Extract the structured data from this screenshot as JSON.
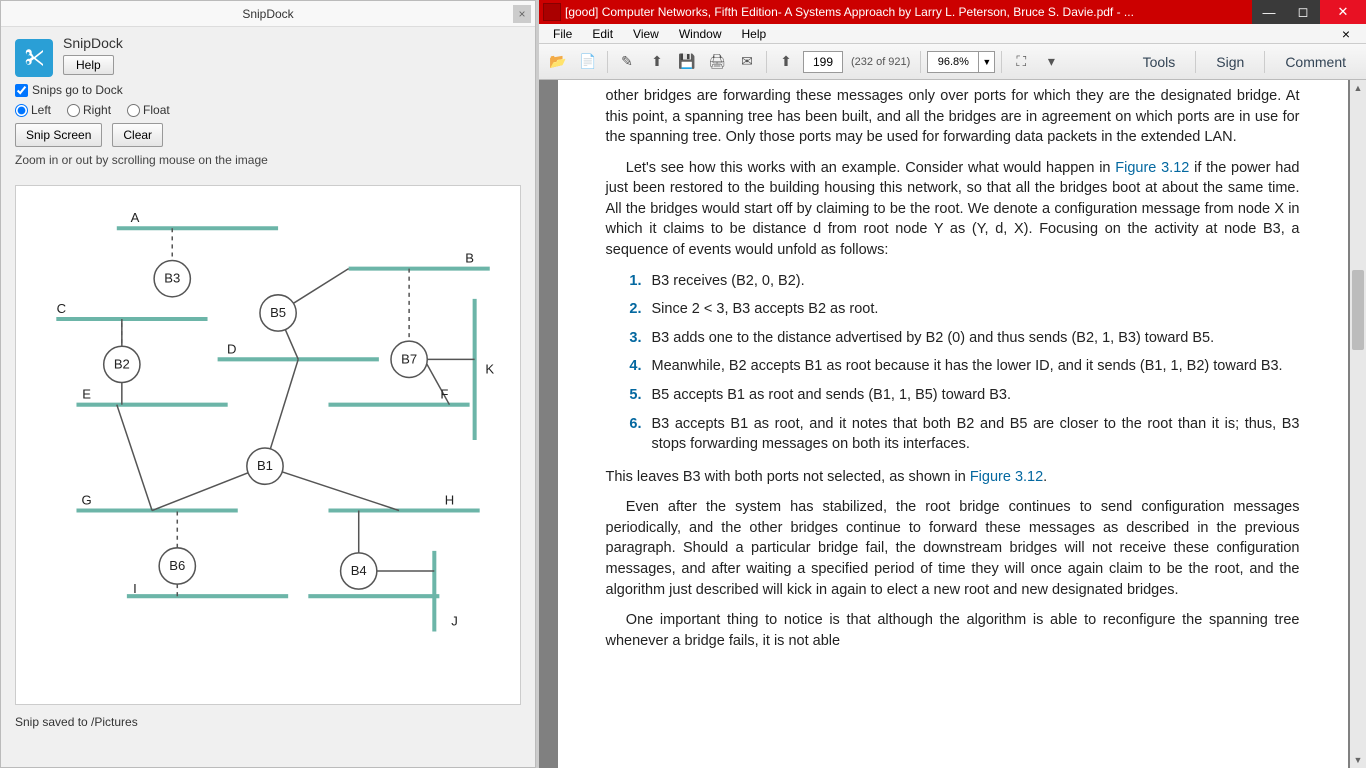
{
  "snipdock": {
    "window_title": "SnipDock",
    "app_title": "SnipDock",
    "help_label": "Help",
    "dock_checkbox": "Snips go to Dock",
    "radios": {
      "left": "Left",
      "right": "Right",
      "float": "Float"
    },
    "snip_button": "Snip Screen",
    "clear_button": "Clear",
    "hint": "Zoom in or out by scrolling mouse on the image",
    "status": "Snip saved to /Pictures",
    "diagram": {
      "nodes": [
        "A",
        "B",
        "C",
        "D",
        "E",
        "F",
        "G",
        "H",
        "I",
        "J",
        "K"
      ],
      "bridges": [
        "B1",
        "B2",
        "B3",
        "B4",
        "B5",
        "B6",
        "B7"
      ]
    }
  },
  "pdf": {
    "window_title": "[good] Computer Networks, Fifth Edition- A Systems Approach by Larry L. Peterson, Bruce S. Davie.pdf - ...",
    "menu": {
      "file": "File",
      "edit": "Edit",
      "view": "View",
      "window": "Window",
      "help": "Help"
    },
    "toolbar": {
      "page_current": "199",
      "page_count": "(232 of 921)",
      "zoom": "96.8%",
      "tools": "Tools",
      "sign": "Sign",
      "comment": "Comment"
    },
    "body": {
      "p1": "other bridges are forwarding these messages only over ports for which they are the designated bridge. At this point, a spanning tree has been built, and all the bridges are in agreement on which ports are in use for the spanning tree. Only those ports may be used for forwarding data packets in the extended LAN.",
      "p2a": "Let's see how this works with an example. Consider what would happen in ",
      "fig312": "Figure 3.12",
      "p2b": " if the power had just been restored to the building housing this network, so that all the bridges boot at about the same time. All the bridges would start off by claiming to be the root. We denote a configuration message from node X in which it claims to be distance d from root node Y as (Y, d, X). Focusing on the activity at node B3, a sequence of events would unfold as follows:",
      "li1": "B3 receives (B2, 0, B2).",
      "li2": "Since 2 < 3, B3 accepts B2 as root.",
      "li3": "B3 adds one to the distance advertised by B2 (0) and thus sends (B2, 1, B3) toward B5.",
      "li4": "Meanwhile, B2 accepts B1 as root because it has the lower ID, and it sends (B1, 1, B2) toward B3.",
      "li5": "B5 accepts B1 as root and sends (B1, 1, B5) toward B3.",
      "li6": "B3 accepts B1 as root, and it notes that both B2 and B5 are closer to the root than it is; thus, B3 stops forwarding messages on both its interfaces.",
      "p3a": "This leaves B3 with both ports not selected, as shown in ",
      "p3b": ".",
      "p4": "Even after the system has stabilized, the root bridge continues to send configuration messages periodically, and the other bridges continue to forward these messages as described in the previous paragraph. Should a particular bridge fail, the downstream bridges will not receive these configuration messages, and after waiting a specified period of time they will once again claim to be the root, and the algorithm just described will kick in again to elect a new root and new designated bridges.",
      "p5": "One important thing to notice is that although the algorithm is able to reconfigure the spanning tree whenever a bridge fails, it is not able"
    }
  }
}
